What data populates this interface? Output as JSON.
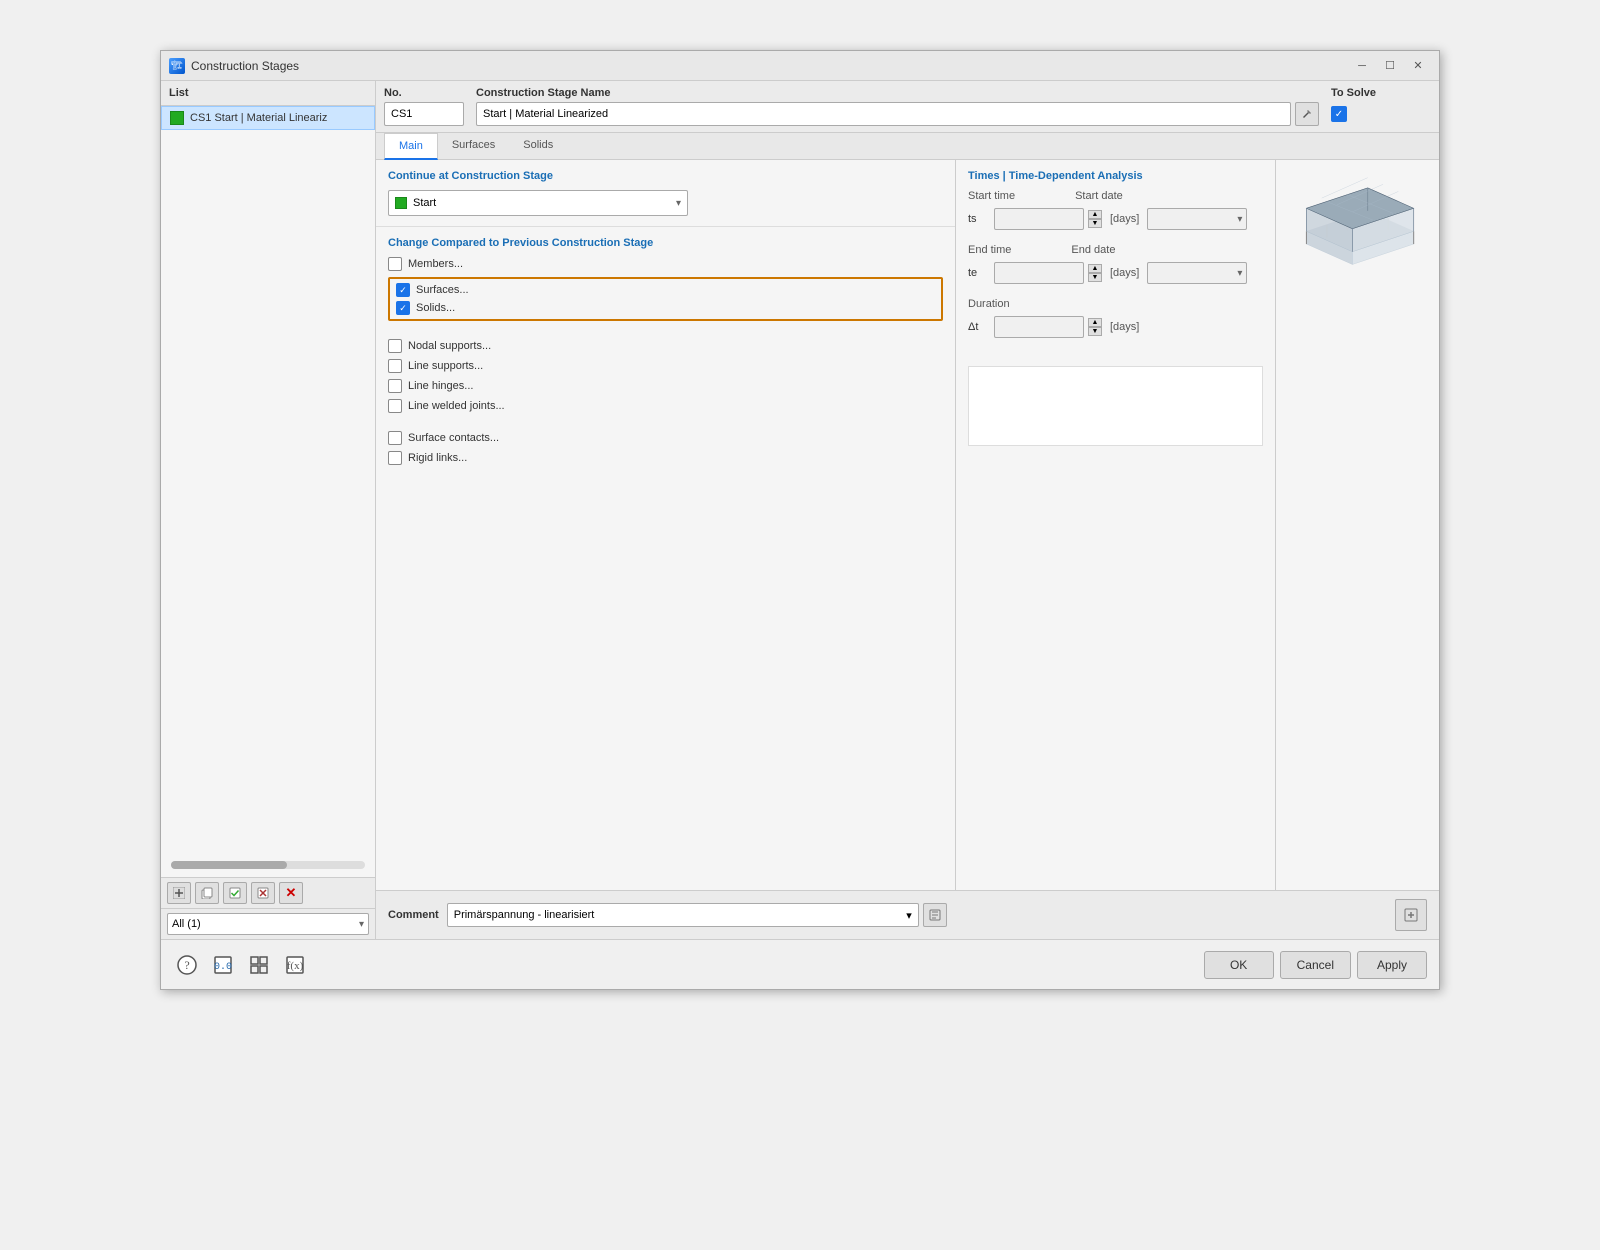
{
  "window": {
    "title": "Construction Stages",
    "icon": "🏗"
  },
  "sidebar": {
    "header": "List",
    "items": [
      {
        "id": "cs1",
        "label": "CS1  Start | Material Lineariz"
      }
    ],
    "footer_dropdown": "All (1)"
  },
  "header": {
    "no_label": "No.",
    "no_value": "CS1",
    "name_label": "Construction Stage Name",
    "name_value": "Start | Material Linearized",
    "to_solve_label": "To Solve"
  },
  "tabs": [
    {
      "id": "main",
      "label": "Main",
      "active": true
    },
    {
      "id": "surfaces",
      "label": "Surfaces",
      "active": false
    },
    {
      "id": "solids",
      "label": "Solids",
      "active": false
    }
  ],
  "continue_section": {
    "title": "Continue at Construction Stage",
    "value": "Start"
  },
  "change_section": {
    "title": "Change Compared to Previous Construction Stage",
    "items": [
      {
        "id": "members",
        "label": "Members...",
        "checked": false,
        "outlined": false
      },
      {
        "id": "surfaces",
        "label": "Surfaces...",
        "checked": true,
        "outlined": true
      },
      {
        "id": "solids",
        "label": "Solids...",
        "checked": true,
        "outlined": true
      },
      {
        "id": "nodal_supports",
        "label": "Nodal supports...",
        "checked": false,
        "outlined": false
      },
      {
        "id": "line_supports",
        "label": "Line supports...",
        "checked": false,
        "outlined": false
      },
      {
        "id": "line_hinges",
        "label": "Line hinges...",
        "checked": false,
        "outlined": false
      },
      {
        "id": "line_welded",
        "label": "Line welded joints...",
        "checked": false,
        "outlined": false
      },
      {
        "id": "surface_contacts",
        "label": "Surface contacts...",
        "checked": false,
        "outlined": false
      },
      {
        "id": "rigid_links",
        "label": "Rigid links...",
        "checked": false,
        "outlined": false
      }
    ]
  },
  "times_section": {
    "title": "Times | Time-Dependent Analysis",
    "start_time_label": "Start time",
    "start_time_sub": "ts",
    "start_time_unit": "[days]",
    "start_date_label": "Start date",
    "end_time_label": "End time",
    "end_time_sub": "te",
    "end_time_unit": "[days]",
    "end_date_label": "End date",
    "duration_label": "Duration",
    "duration_sub": "Δt",
    "duration_unit": "[days]"
  },
  "comment_section": {
    "label": "Comment",
    "value": "Primärspannung - linearisiert"
  },
  "bottom": {
    "ok_label": "OK",
    "cancel_label": "Cancel",
    "apply_label": "Apply"
  },
  "toolbar": {
    "add_icon": "➕",
    "copy_icon": "📋",
    "check_icon": "✓",
    "uncheck_icon": "✗",
    "delete_icon": "✕"
  }
}
